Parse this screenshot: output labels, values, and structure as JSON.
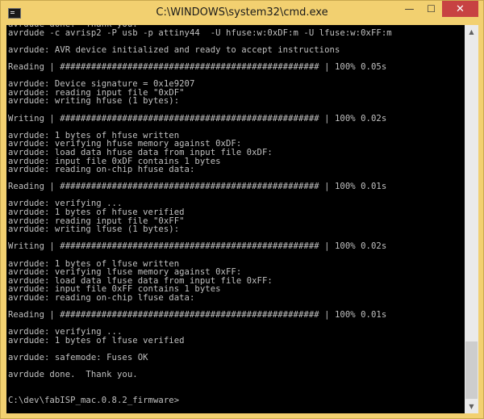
{
  "window": {
    "title": "C:\\WINDOWS\\system32\\cmd.exe",
    "app_icon": "console-icon",
    "controls": {
      "minimize": "—",
      "maximize": "☐",
      "close": "✕"
    }
  },
  "scrollbar": {
    "up": "▲",
    "down": "▼"
  },
  "console": {
    "lines": [
      "avrdude done.  Thank you.",
      "avrdude -c avrisp2 -P usb -p attiny44  -U hfuse:w:0xDF:m -U lfuse:w:0xFF:m",
      "",
      "avrdude: AVR device initialized and ready to accept instructions",
      "",
      "Reading | ################################################## | 100% 0.05s",
      "",
      "avrdude: Device signature = 0x1e9207",
      "avrdude: reading input file \"0xDF\"",
      "avrdude: writing hfuse (1 bytes):",
      "",
      "Writing | ################################################## | 100% 0.02s",
      "",
      "avrdude: 1 bytes of hfuse written",
      "avrdude: verifying hfuse memory against 0xDF:",
      "avrdude: load data hfuse data from input file 0xDF:",
      "avrdude: input file 0xDF contains 1 bytes",
      "avrdude: reading on-chip hfuse data:",
      "",
      "Reading | ################################################## | 100% 0.01s",
      "",
      "avrdude: verifying ...",
      "avrdude: 1 bytes of hfuse verified",
      "avrdude: reading input file \"0xFF\"",
      "avrdude: writing lfuse (1 bytes):",
      "",
      "Writing | ################################################## | 100% 0.02s",
      "",
      "avrdude: 1 bytes of lfuse written",
      "avrdude: verifying lfuse memory against 0xFF:",
      "avrdude: load data lfuse data from input file 0xFF:",
      "avrdude: input file 0xFF contains 1 bytes",
      "avrdude: reading on-chip lfuse data:",
      "",
      "Reading | ################################################## | 100% 0.01s",
      "",
      "avrdude: verifying ...",
      "avrdude: 1 bytes of lfuse verified",
      "",
      "avrdude: safemode: Fuses OK",
      "",
      "avrdude done.  Thank you.",
      "",
      "",
      "C:\\dev\\fabISP_mac.0.8.2_firmware>"
    ]
  }
}
